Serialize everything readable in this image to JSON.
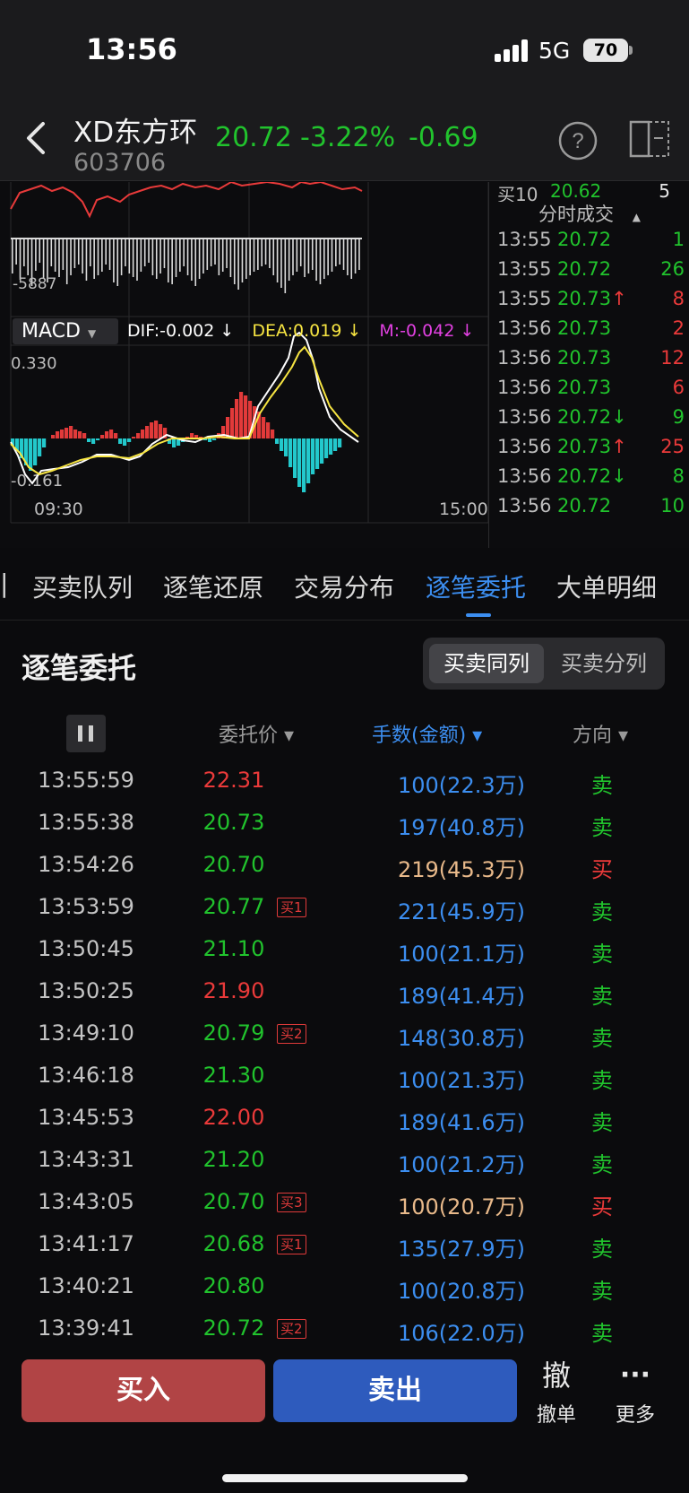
{
  "status": {
    "time": "13:56",
    "network": "5G",
    "battery": "70"
  },
  "header": {
    "name": "XD东方环",
    "code": "603706",
    "price": "20.72",
    "change_pct": "-3.22%",
    "change": "-0.69"
  },
  "chart": {
    "vol_label": "-5887",
    "indicator": "MACD",
    "dif": "DIF:-0.002 ↓",
    "dea": "DEA:0.019 ↓",
    "m": "M:-0.042 ↓",
    "y_top": "0.330",
    "y_bottom": "-0.161",
    "x_start": "09:30",
    "x_end": "15:00"
  },
  "depth_partial": {
    "label": "买10",
    "price": "20.62",
    "vol": "5"
  },
  "ticks": {
    "title": "分时成交",
    "rows": [
      {
        "t": "13:55",
        "p": "20.72",
        "arrow": "",
        "v": "1",
        "pc": "#21c32d",
        "vc": "#21c32d"
      },
      {
        "t": "13:55",
        "p": "20.72",
        "arrow": "",
        "v": "26",
        "pc": "#21c32d",
        "vc": "#21c32d"
      },
      {
        "t": "13:55",
        "p": "20.73",
        "arrow": "↑",
        "v": "8",
        "pc": "#21c32d",
        "vc": "#ea3a3a"
      },
      {
        "t": "13:56",
        "p": "20.73",
        "arrow": "",
        "v": "2",
        "pc": "#21c32d",
        "vc": "#ea3a3a"
      },
      {
        "t": "13:56",
        "p": "20.73",
        "arrow": "",
        "v": "12",
        "pc": "#21c32d",
        "vc": "#ea3a3a"
      },
      {
        "t": "13:56",
        "p": "20.73",
        "arrow": "",
        "v": "6",
        "pc": "#21c32d",
        "vc": "#ea3a3a"
      },
      {
        "t": "13:56",
        "p": "20.72",
        "arrow": "↓",
        "v": "9",
        "pc": "#21c32d",
        "vc": "#21c32d"
      },
      {
        "t": "13:56",
        "p": "20.73",
        "arrow": "↑",
        "v": "25",
        "pc": "#21c32d",
        "vc": "#ea3a3a"
      },
      {
        "t": "13:56",
        "p": "20.72",
        "arrow": "↓",
        "v": "8",
        "pc": "#21c32d",
        "vc": "#21c32d"
      },
      {
        "t": "13:56",
        "p": "20.72",
        "arrow": "",
        "v": "10",
        "pc": "#21c32d",
        "vc": "#21c32d"
      }
    ]
  },
  "tabs": [
    "买卖队列",
    "逐笔还原",
    "交易分布",
    "逐笔委托",
    "大单明细"
  ],
  "active_tab": "逐笔委托",
  "section": {
    "title": "逐笔委托",
    "seg_same": "买卖同列",
    "seg_split": "买卖分列"
  },
  "columns": {
    "price": "委托价",
    "vol": "手数(金额)",
    "dir": "方向"
  },
  "orders": [
    {
      "time": "13:55:59",
      "price": "22.31",
      "pc": "#ea3a3a",
      "tag": "",
      "vol": "100(22.3万)",
      "vc": "#3c8ef0",
      "dir": "卖",
      "dc": "#21c32d"
    },
    {
      "time": "13:55:38",
      "price": "20.73",
      "pc": "#21c32d",
      "tag": "",
      "vol": "197(40.8万)",
      "vc": "#3c8ef0",
      "dir": "卖",
      "dc": "#21c32d"
    },
    {
      "time": "13:54:26",
      "price": "20.70",
      "pc": "#21c32d",
      "tag": "",
      "vol": "219(45.3万)",
      "vc": "#e8b98a",
      "dir": "买",
      "dc": "#ea3a3a"
    },
    {
      "time": "13:53:59",
      "price": "20.77",
      "pc": "#21c32d",
      "tag": "买1",
      "vol": "221(45.9万)",
      "vc": "#3c8ef0",
      "dir": "卖",
      "dc": "#21c32d"
    },
    {
      "time": "13:50:45",
      "price": "21.10",
      "pc": "#21c32d",
      "tag": "",
      "vol": "100(21.1万)",
      "vc": "#3c8ef0",
      "dir": "卖",
      "dc": "#21c32d"
    },
    {
      "time": "13:50:25",
      "price": "21.90",
      "pc": "#ea3a3a",
      "tag": "",
      "vol": "189(41.4万)",
      "vc": "#3c8ef0",
      "dir": "卖",
      "dc": "#21c32d"
    },
    {
      "time": "13:49:10",
      "price": "20.79",
      "pc": "#21c32d",
      "tag": "买2",
      "vol": "148(30.8万)",
      "vc": "#3c8ef0",
      "dir": "卖",
      "dc": "#21c32d"
    },
    {
      "time": "13:46:18",
      "price": "21.30",
      "pc": "#21c32d",
      "tag": "",
      "vol": "100(21.3万)",
      "vc": "#3c8ef0",
      "dir": "卖",
      "dc": "#21c32d"
    },
    {
      "time": "13:45:53",
      "price": "22.00",
      "pc": "#ea3a3a",
      "tag": "",
      "vol": "189(41.6万)",
      "vc": "#3c8ef0",
      "dir": "卖",
      "dc": "#21c32d"
    },
    {
      "time": "13:43:31",
      "price": "21.20",
      "pc": "#21c32d",
      "tag": "",
      "vol": "100(21.2万)",
      "vc": "#3c8ef0",
      "dir": "卖",
      "dc": "#21c32d"
    },
    {
      "time": "13:43:05",
      "price": "20.70",
      "pc": "#21c32d",
      "tag": "买3",
      "vol": "100(20.7万)",
      "vc": "#e8b98a",
      "dir": "买",
      "dc": "#ea3a3a"
    },
    {
      "time": "13:41:17",
      "price": "20.68",
      "pc": "#21c32d",
      "tag": "买1",
      "vol": "135(27.9万)",
      "vc": "#3c8ef0",
      "dir": "卖",
      "dc": "#21c32d"
    },
    {
      "time": "13:40:21",
      "price": "20.80",
      "pc": "#21c32d",
      "tag": "",
      "vol": "100(20.8万)",
      "vc": "#3c8ef0",
      "dir": "卖",
      "dc": "#21c32d"
    },
    {
      "time": "13:39:41",
      "price": "20.72",
      "pc": "#21c32d",
      "tag": "买2",
      "vol": "106(22.0万)",
      "vc": "#3c8ef0",
      "dir": "卖",
      "dc": "#21c32d"
    }
  ],
  "bottom": {
    "buy": "买入",
    "sell": "卖出",
    "cancel_icon": "撤",
    "cancel": "撤单",
    "more_icon": "···",
    "more": "更多"
  }
}
